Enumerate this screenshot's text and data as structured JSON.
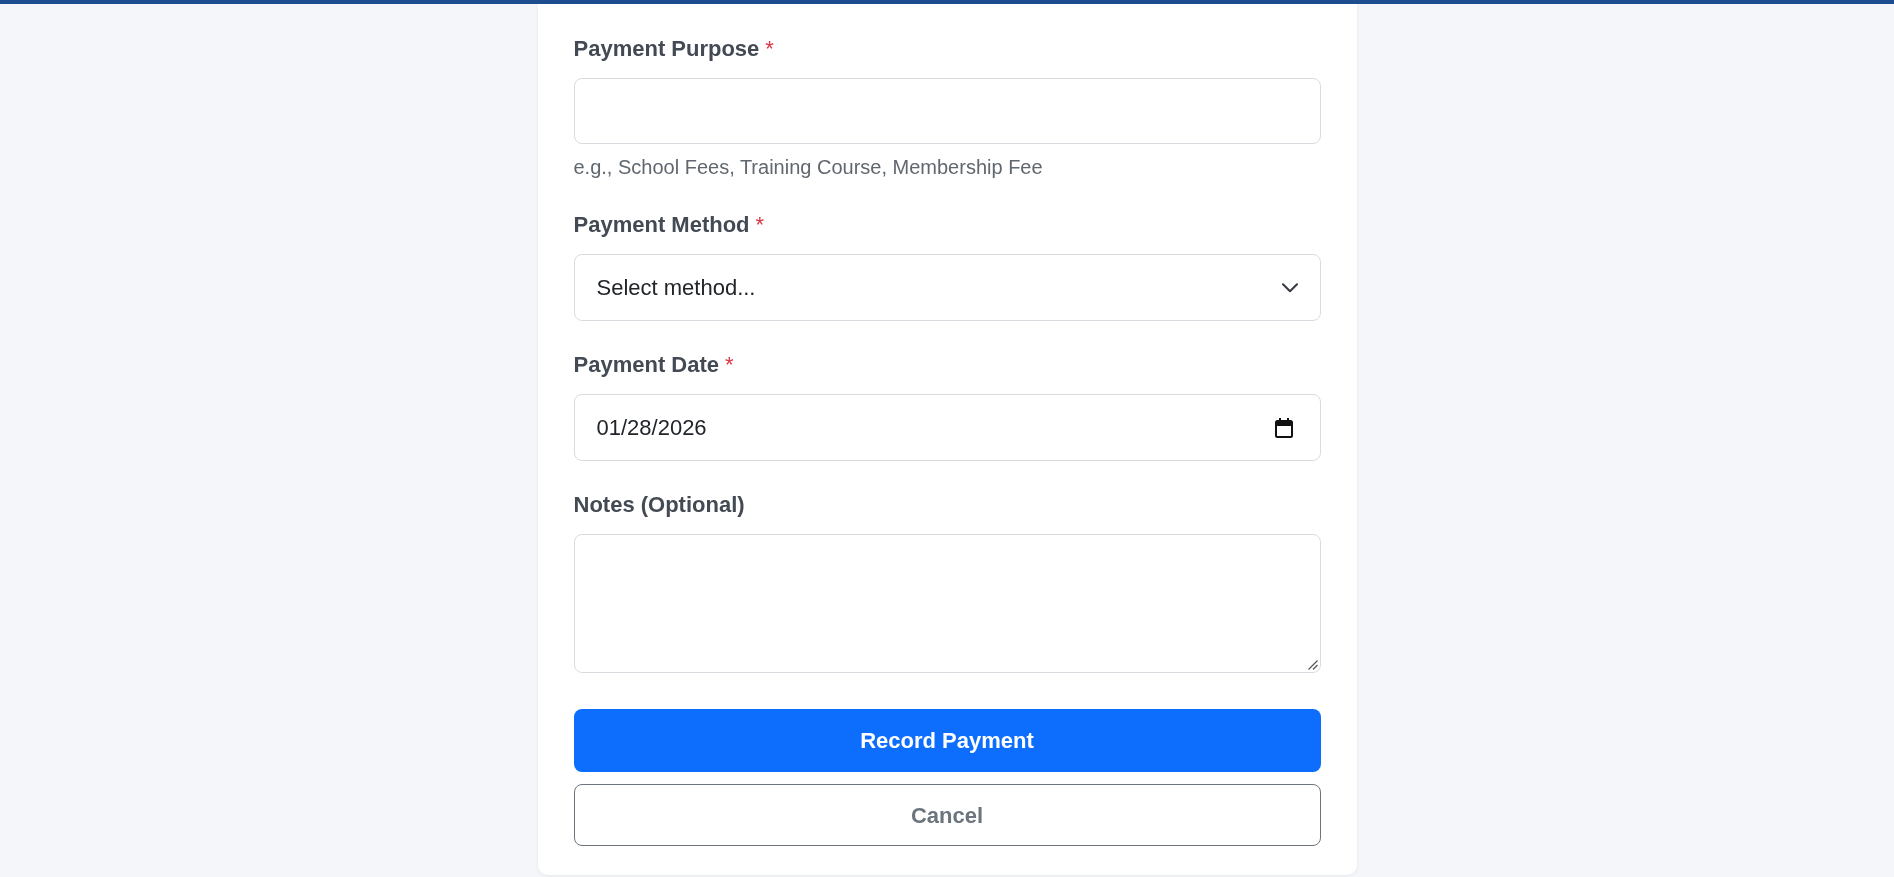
{
  "form": {
    "fields": [
      {
        "kind": "text",
        "label": "Payment Purpose",
        "required_mark": "*",
        "help": "e.g., School Fees, Training Course, Membership Fee"
      },
      {
        "kind": "select",
        "label": "Payment Method",
        "required_mark": "*",
        "placeholder": "Select method..."
      },
      {
        "kind": "date",
        "label": "Payment Date",
        "required_mark": "*",
        "value": "01/28/2026"
      },
      {
        "kind": "textarea",
        "label": "Notes (Optional)"
      }
    ],
    "buttons": [
      {
        "kind": "primary",
        "label": "Record Payment"
      },
      {
        "kind": "secondary",
        "label": "Cancel"
      }
    ]
  }
}
